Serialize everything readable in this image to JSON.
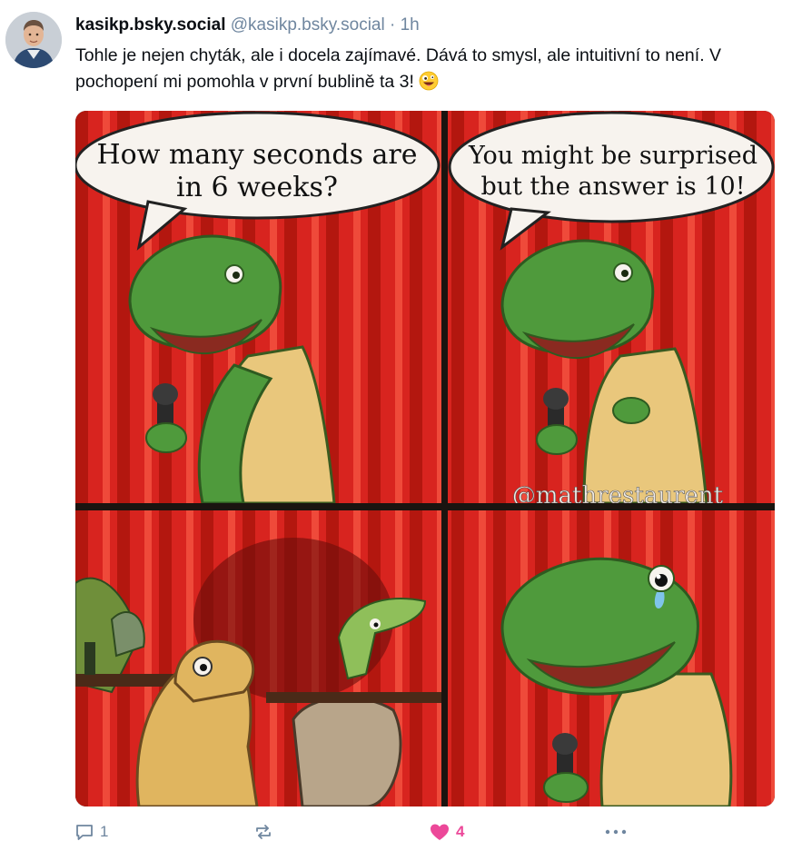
{
  "post": {
    "author_name": "kasikp.bsky.social",
    "author_handle": "@kasikp.bsky.social",
    "separator": "·",
    "time": "1h",
    "text": "Tohle je nejen chyták, ale i docela zajímavé. Dává to smysl, ale intuitivní to není. V pochopení mi pomohla v první bublině ta 3!",
    "text_emoji": "grinning-crazy-face-emoji"
  },
  "comic": {
    "bubble_left_line1": "How many seconds are",
    "bubble_left_line2": "in 6 weeks?",
    "bubble_right_line1": "You might be surprised",
    "bubble_right_line2": "but the answer is 10!",
    "watermark": "@mathrestaurent",
    "colors": {
      "curtain": "#d8241f",
      "curtain_dark": "#a8140f",
      "dino_green": "#4f9a3c",
      "belly": "#e9c77c"
    }
  },
  "actions": {
    "reply_count": "1",
    "repost_count": "",
    "like_count": "4",
    "like_color": "#ec4899",
    "icons": [
      "reply-icon",
      "repost-icon",
      "heart-icon",
      "more-icon"
    ]
  }
}
